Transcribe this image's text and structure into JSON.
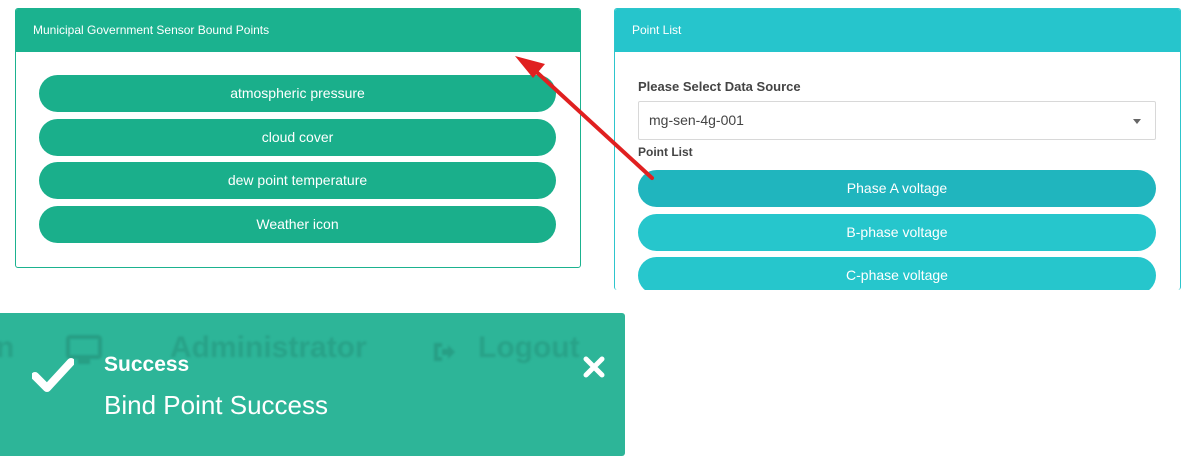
{
  "left_panel": {
    "title": "Municipal Government Sensor Bound Points",
    "points": [
      "atmospheric pressure",
      "cloud cover",
      "dew point temperature",
      "Weather icon"
    ]
  },
  "right_panel": {
    "title": "Point List",
    "data_source_label": "Please Select Data Source",
    "data_source_value": "mg-sen-4g-001",
    "point_list_label": "Point List",
    "points": [
      "Phase A voltage",
      "B-phase voltage",
      "C-phase voltage"
    ]
  },
  "background_header": {
    "fragment": "n",
    "user": "Administrator",
    "logout": "Logout"
  },
  "toast": {
    "title": "Success",
    "message": "Bind Point Success"
  },
  "colors": {
    "green": "#1bb28f",
    "teal": "#26c5cc",
    "toast": "#2db598",
    "arrow": "#e02020"
  }
}
